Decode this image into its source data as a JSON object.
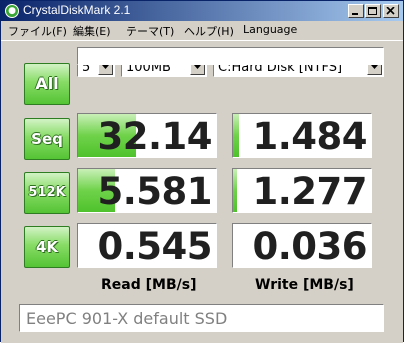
{
  "window": {
    "title": "CrystalDiskMark 2.1"
  },
  "menu": [
    "ファイル(F)",
    "編集(E)",
    "テーマ(T)",
    "ヘルプ(H)",
    "Language"
  ],
  "controls": {
    "all_label": "All",
    "count": "5",
    "size": "100MB",
    "drive": "C:Hard Disk [NTFS]",
    "status": ""
  },
  "tests": [
    {
      "label": "Seq",
      "read": "32.14",
      "write": "1.484",
      "read_fill": 0.42,
      "write_fill": 0.04
    },
    {
      "label": "512K",
      "read": "5.581",
      "write": "1.277",
      "read_fill": 0.27,
      "write_fill": 0.03
    },
    {
      "label": "4K",
      "read": "0.545",
      "write": "0.036",
      "read_fill": 0.0,
      "write_fill": 0.0
    }
  ],
  "columns": {
    "read": "Read [MB/s]",
    "write": "Write [MB/s]"
  },
  "comment": "EeePC 901-X default SSD",
  "colors": {
    "accent_green": "#54c334",
    "title_start": "#0a246a",
    "title_end": "#a6caf0"
  },
  "icons": [
    "app-icon",
    "minimize-icon",
    "maximize-icon",
    "close-icon",
    "chevron-down-icon"
  ]
}
